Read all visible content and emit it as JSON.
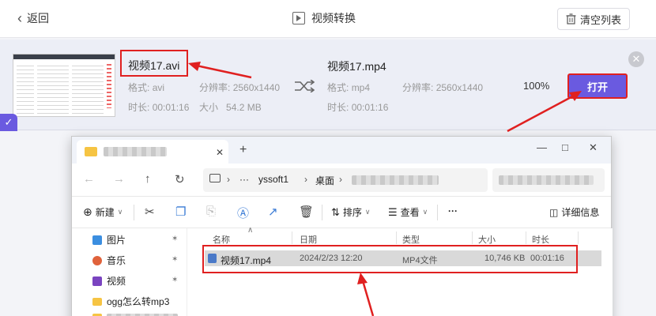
{
  "header": {
    "back_label": "返回",
    "title": "视频转换",
    "clear_label": "清空列表"
  },
  "source": {
    "name": "视频17.avi",
    "format_label": "格式:",
    "format": "avi",
    "resolution_label": "分辨率:",
    "resolution": "2560x1440",
    "duration_label": "时长:",
    "duration": "00:01:16",
    "size_label": "大小",
    "size": "54.2 MB"
  },
  "target": {
    "name": "视频17.mp4",
    "format_label": "格式:",
    "format": "mp4",
    "resolution_label": "分辨率:",
    "resolution": "2560x1440",
    "duration_label": "时长:",
    "duration": "00:01:16"
  },
  "progress": {
    "text": "100%",
    "value": 100
  },
  "open_label": "打开",
  "explorer": {
    "path": [
      "yssoft1",
      "桌面"
    ],
    "more": "···",
    "toolbar": {
      "new_label": "新建",
      "sort_label": "排序",
      "view_label": "查看",
      "more": "···",
      "details_label": "详细信息"
    },
    "sidebar": [
      {
        "label": "图片",
        "icon": "picture-icon",
        "color": "#3b8ee0"
      },
      {
        "label": "音乐",
        "icon": "music-icon",
        "color": "#e0623b"
      },
      {
        "label": "视频",
        "icon": "video-icon",
        "color": "#7a44c0"
      },
      {
        "label": "ogg怎么转mp3",
        "icon": "folder-icon",
        "color": "#f6c443"
      }
    ],
    "columns": [
      "名称",
      "日期",
      "类型",
      "大小",
      "时长"
    ],
    "files": [
      {
        "name": "视频17.mp4",
        "date": "2024/2/23 12:20",
        "type": "MP4文件",
        "size": "10,746 KB",
        "duration": "00:01:16"
      }
    ]
  },
  "colors": {
    "accent": "#6a5ae0",
    "annotation": "#e02020"
  }
}
